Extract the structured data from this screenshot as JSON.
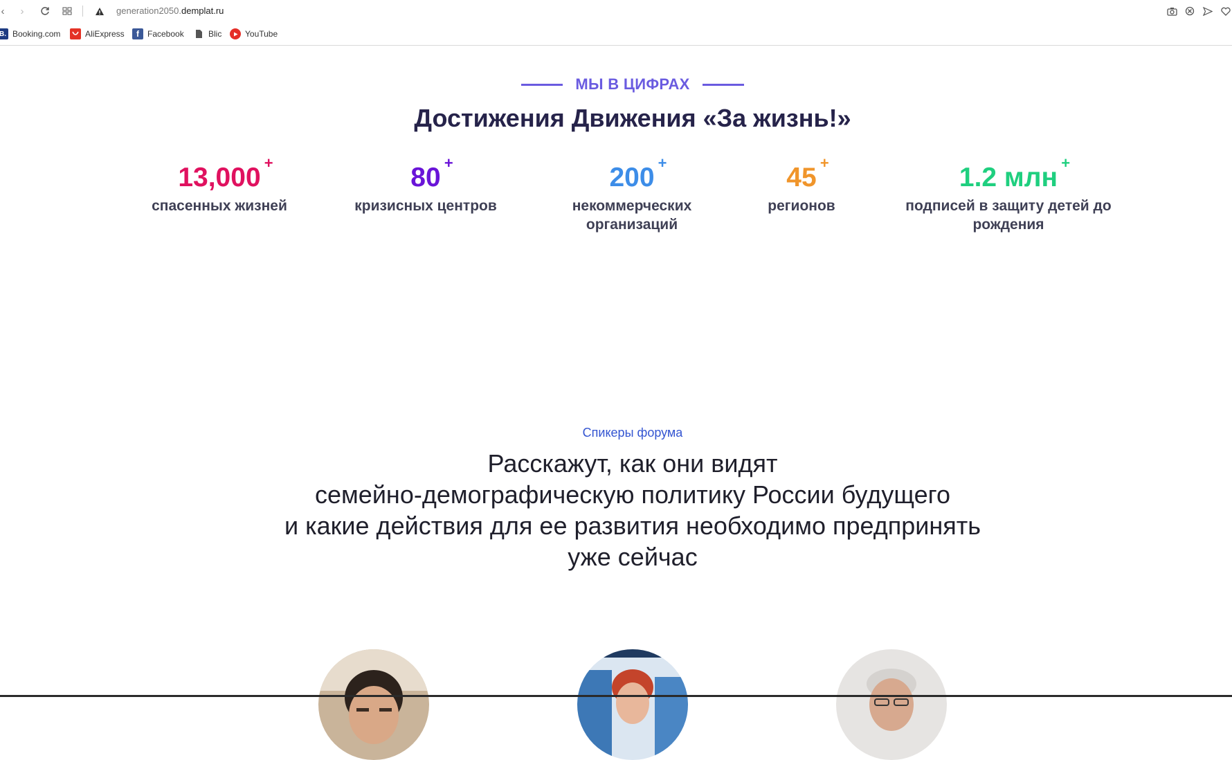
{
  "browser": {
    "url_host": "generation2050.",
    "url_domain": "demplat.ru",
    "bookmarks": [
      {
        "label": "Booking.com",
        "icon": "booking-icon"
      },
      {
        "label": "AliExpress",
        "icon": "aliexpress-icon"
      },
      {
        "label": "Facebook",
        "icon": "facebook-icon"
      },
      {
        "label": "Blic",
        "icon": "document-icon"
      },
      {
        "label": "YouTube",
        "icon": "youtube-icon"
      }
    ]
  },
  "achievements": {
    "eyebrow": "МЫ В ЦИФРАХ",
    "title": "Достижения Движения «За жизнь!»",
    "stats": [
      {
        "number": "13,000",
        "plus": "+",
        "label": "спасенных жизней",
        "color": "#e0115f"
      },
      {
        "number": "80",
        "plus": "+",
        "label": "кризисных центров",
        "color": "#6a14d8"
      },
      {
        "number": "200",
        "plus": "+",
        "label_line1": "некоммерческих",
        "label_line2": "организаций",
        "color": "#3d8de8"
      },
      {
        "number": "45",
        "plus": "+",
        "label": "регионов",
        "color": "#f0952b"
      },
      {
        "number": "1.2 млн",
        "plus": "+",
        "label_line1": "подписей в защиту детей до",
        "label_line2": "рождения",
        "color": "#1fcf7f"
      }
    ]
  },
  "speakers": {
    "eyebrow": "Спикеры форума",
    "title_line1": "Расскажут, как они видят",
    "title_line2": "семейно-демографическую политику России будущего",
    "title_line3": "и какие действия для ее развития необходимо предпринять",
    "title_line4": "уже сейчас"
  },
  "colors": {
    "accent_purple": "#6a5be0",
    "heading_dark": "#26234a",
    "link_blue": "#3455d1"
  }
}
